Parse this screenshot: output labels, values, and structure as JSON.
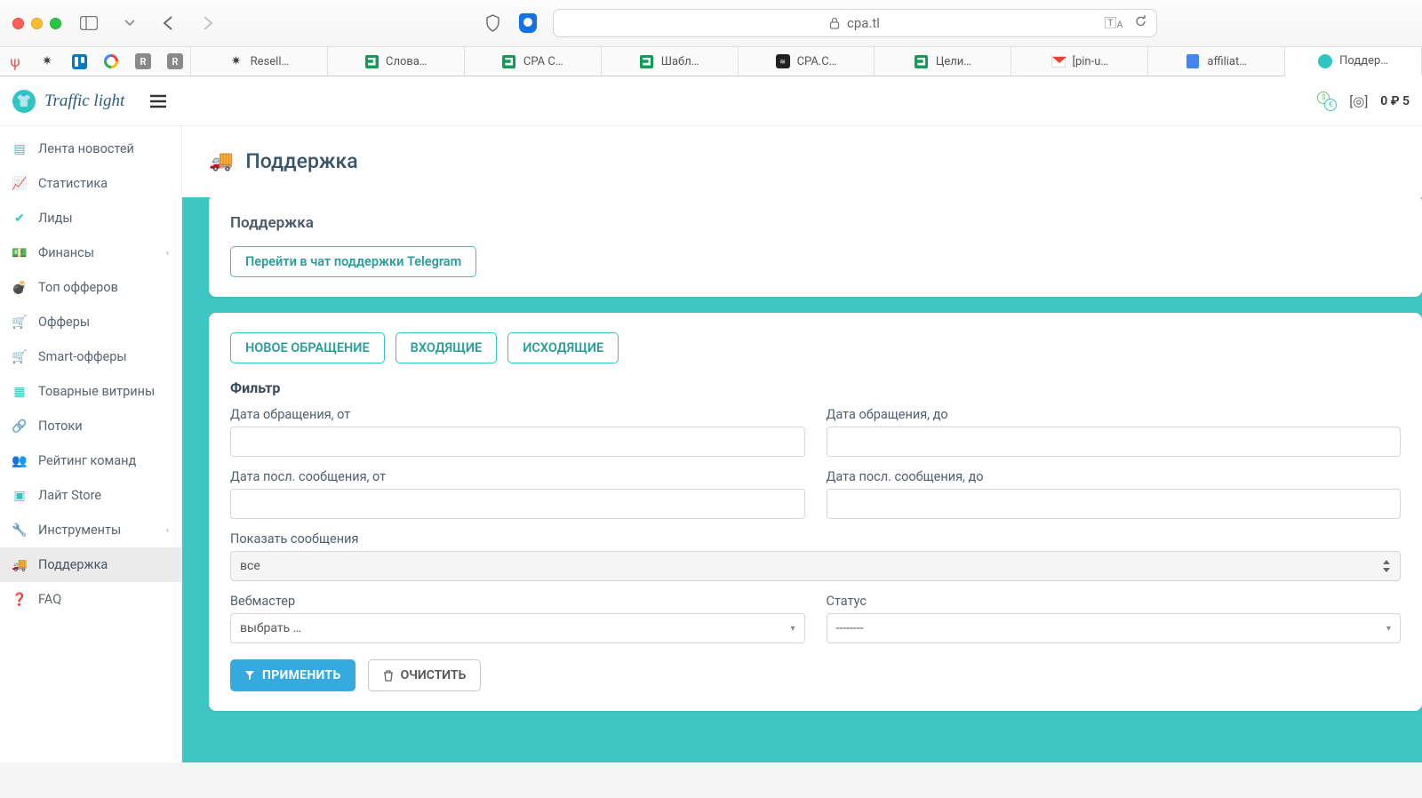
{
  "browser": {
    "url": "cpa.tl",
    "tabs": [
      {
        "label": "Resell…"
      },
      {
        "label": "Слова…"
      },
      {
        "label": "CPA С…"
      },
      {
        "label": "Шабл…"
      },
      {
        "label": "CPA.С…"
      },
      {
        "label": "Цели…"
      },
      {
        "label": "[pin-u…"
      },
      {
        "label": "affiliat…"
      },
      {
        "label": "Поддер…"
      }
    ]
  },
  "header": {
    "brand": "Traffic light",
    "balance": "0 ₽  5"
  },
  "sidebar": {
    "items": [
      {
        "label": "Лента новостей"
      },
      {
        "label": "Статистика"
      },
      {
        "label": "Лиды"
      },
      {
        "label": "Финансы",
        "expandable": true
      },
      {
        "label": "Топ офферов"
      },
      {
        "label": "Офферы"
      },
      {
        "label": "Smart-офферы"
      },
      {
        "label": "Товарные витрины"
      },
      {
        "label": "Потоки"
      },
      {
        "label": "Рейтинг команд"
      },
      {
        "label": "Лайт Store"
      },
      {
        "label": "Инструменты",
        "expandable": true
      },
      {
        "label": "Поддержка",
        "active": true
      },
      {
        "label": "FAQ"
      }
    ]
  },
  "page": {
    "title": "Поддержка",
    "support_card_title": "Поддержка",
    "telegram_button": "Перейти в чат поддержки Telegram",
    "tabs": {
      "new": "НОВОЕ ОБРАЩЕНИЕ",
      "inbox": "ВХОДЯЩИЕ",
      "outbox": "ИСХОДЯЩИЕ"
    },
    "filter_heading": "Фильтр",
    "labels": {
      "date_from": "Дата обращения, от",
      "date_to": "Дата обращения, до",
      "last_msg_from": "Дата посл. сообщения, от",
      "last_msg_to": "Дата посл. сообщения, до",
      "show_messages": "Показать сообщения",
      "webmaster": "Вебмастер",
      "status": "Статус"
    },
    "values": {
      "show_messages": "все",
      "webmaster_placeholder": "выбрать …",
      "status_placeholder": "--------"
    },
    "buttons": {
      "apply": "ПРИМЕНИТЬ",
      "clear": "ОЧИСТИТЬ"
    }
  }
}
